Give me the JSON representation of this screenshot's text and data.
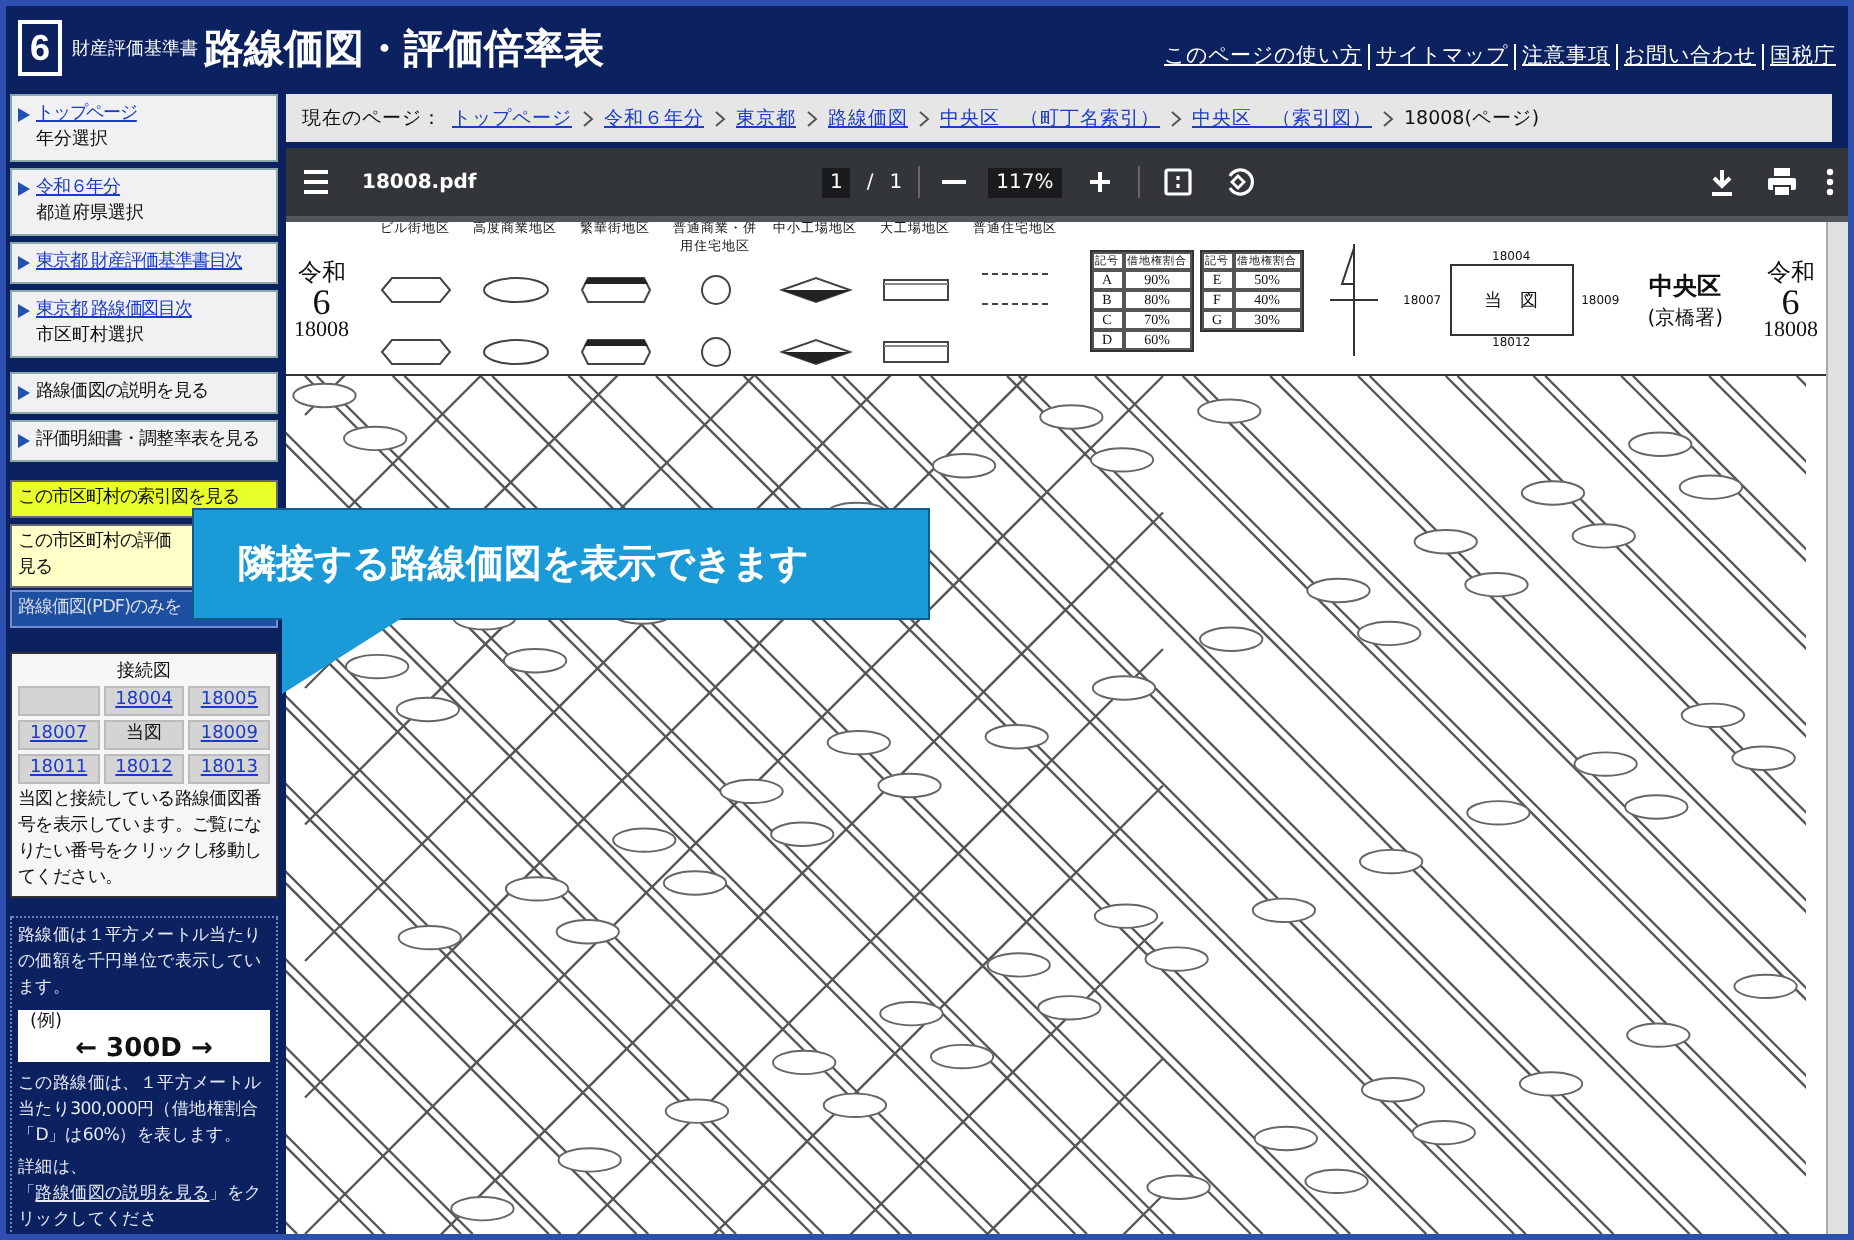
{
  "header": {
    "badge": "6",
    "subtitle": "財産評価基準書",
    "title": "路線価図・評価倍率表",
    "links": [
      "このページの使い方",
      "サイトマップ",
      "注意事項",
      "お問い合わせ",
      "国税庁"
    ]
  },
  "sidebar": {
    "items": [
      {
        "kind": "link",
        "label": "トップページ",
        "sub": "年分選択"
      },
      {
        "kind": "link",
        "label": "令和６年分",
        "sub": "都道府県選択"
      },
      {
        "kind": "link",
        "label": "東京都 財産評価基準書目次"
      },
      {
        "kind": "link",
        "label": "東京都 路線価図目次",
        "sub": "市区町村選択"
      },
      {
        "kind": "plain",
        "label": "路線価図の説明を見る"
      },
      {
        "kind": "plain",
        "label": "評価明細書・調整率表を見る"
      },
      {
        "kind": "yellow",
        "label": "この市区町村の索引図を見る"
      },
      {
        "kind": "pale",
        "label": "この市区町村の評価",
        "sub": "見る"
      },
      {
        "kind": "blue",
        "label": "路線価図(PDF)のみを"
      }
    ],
    "adjacent": {
      "title": "接続図",
      "cells": [
        {
          "kind": "blank"
        },
        {
          "kind": "link",
          "label": "18004"
        },
        {
          "kind": "link",
          "label": "18005"
        },
        {
          "kind": "link",
          "label": "18007"
        },
        {
          "kind": "text",
          "label": "当図"
        },
        {
          "kind": "link",
          "label": "18009"
        },
        {
          "kind": "link",
          "label": "18011"
        },
        {
          "kind": "link",
          "label": "18012"
        },
        {
          "kind": "link",
          "label": "18013"
        }
      ],
      "note": "当図と接続している路線価図番号を表示しています。ご覧になりたい番号をクリックし移動してください。"
    },
    "explain": {
      "text": "路線価は１平方メートル当たりの価額を千円単位で表示しています。",
      "example_label": "(例)",
      "example": "← 300D →",
      "detail": "この路線価は、１平方メートル当たり300,000円（借地権割合「D」は60%）を表します。",
      "more_before": "詳細は、「",
      "more_link": "路線価図の説明を見る",
      "more_after": "」をクリックしてくださ"
    }
  },
  "breadcrumb": {
    "label": "現在のページ：",
    "links": [
      "トップページ",
      "令和６年分",
      "東京都",
      "路線価図",
      "中央区　（町丁名索引）",
      "中央区　（索引図）"
    ],
    "current": "18008(ページ)"
  },
  "viewer": {
    "filename": "18008.pdf",
    "page": "1",
    "separator": "/",
    "pages": "1",
    "zoom": "117%"
  },
  "sheet": {
    "stamps": [
      {
        "era": "令和",
        "year": "6",
        "number": "18008"
      },
      {
        "era": "令和",
        "year": "6",
        "number": "18008"
      }
    ],
    "zones": [
      {
        "kind": "hex",
        "label": "ビル街地区"
      },
      {
        "kind": "oval",
        "label": "高度商業地区"
      },
      {
        "kind": "octagon",
        "label": "繁華街地区"
      },
      {
        "kind": "circle",
        "label": "普通商業・併用住宅地区"
      },
      {
        "kind": "diamond",
        "label": "中小工場地区"
      },
      {
        "kind": "rect",
        "label": "大工場地区"
      },
      {
        "kind": "line",
        "label": "普通住宅地区"
      }
    ],
    "ratio_tables": [
      {
        "header": [
          "記号",
          "借地権割合"
        ],
        "rows": [
          {
            "code": "A",
            "pct": "90%"
          },
          {
            "code": "B",
            "pct": "80%"
          },
          {
            "code": "C",
            "pct": "70%"
          },
          {
            "code": "D",
            "pct": "60%"
          }
        ]
      },
      {
        "header": [
          "記号",
          "借地権割合"
        ],
        "rows": [
          {
            "code": "E",
            "pct": "50%"
          },
          {
            "code": "F",
            "pct": "40%"
          },
          {
            "code": "G",
            "pct": "30%"
          }
        ]
      }
    ],
    "index_map": {
      "center": "当　図",
      "north": "18004",
      "west": "18007",
      "east": "18009",
      "south": "18012"
    },
    "ward": "中央区",
    "office": "(京橋署)"
  },
  "callout": "隣接する路線価図を表示できます"
}
